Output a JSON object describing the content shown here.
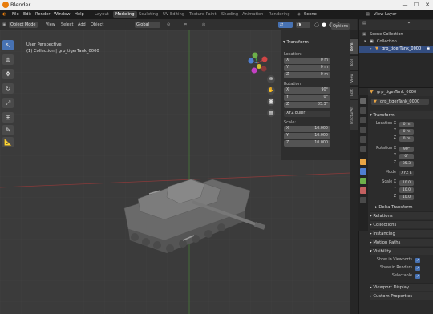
{
  "window": {
    "title": "Blender",
    "minimize": "—",
    "maximize": "☐",
    "close": "✕"
  },
  "menu": [
    "File",
    "Edit",
    "Render",
    "Window",
    "Help"
  ],
  "workspaces": [
    "Layout",
    "Modeling",
    "Sculpting",
    "UV Editing",
    "Texture Paint",
    "Shading",
    "Animation",
    "Rendering"
  ],
  "scene": {
    "label": "Scene",
    "view_layer": "View Layer"
  },
  "viewport_header": {
    "mode": "Object Mode",
    "view": "View",
    "select": "Select",
    "add": "Add",
    "object": "Object",
    "orientation": "Global",
    "options": "Options"
  },
  "viewport": {
    "perspective": "User Perspective",
    "collection_info": "(1) Collection | grp_tigerTank_0000"
  },
  "n_panel": {
    "title": "Transform",
    "location_label": "Location:",
    "location": [
      {
        "axis": "X",
        "value": "0 m"
      },
      {
        "axis": "Y",
        "value": "0 m"
      },
      {
        "axis": "Z",
        "value": "0 m"
      }
    ],
    "rotation_label": "Rotation:",
    "rotation": [
      {
        "axis": "X",
        "value": "90°"
      },
      {
        "axis": "Y",
        "value": "0°"
      },
      {
        "axis": "Z",
        "value": "85.3°"
      }
    ],
    "rotation_mode": "XYZ Euler",
    "scale_label": "Scale:",
    "scale": [
      {
        "axis": "X",
        "value": "10.000"
      },
      {
        "axis": "Y",
        "value": "10.000"
      },
      {
        "axis": "Z",
        "value": "10.000"
      }
    ]
  },
  "side_tabs": [
    "Item",
    "Tool",
    "View",
    "Edit",
    "FracturAlt"
  ],
  "outliner": {
    "root": "Scene Collection",
    "collection": "Collection",
    "object": "grp_tigerTank_0000"
  },
  "properties": {
    "object_name": "grp_tigerTank_0000",
    "object_field": "grp_tigerTank_0000",
    "transform_title": "Transform",
    "location": [
      {
        "label": "Location X",
        "value": "0 m"
      },
      {
        "label": "Y",
        "value": "0 m"
      },
      {
        "label": "Z",
        "value": "0 m"
      }
    ],
    "rotation": [
      {
        "label": "Rotation X",
        "value": "90°"
      },
      {
        "label": "Y",
        "value": "0°"
      },
      {
        "label": "Z",
        "value": "85.3"
      }
    ],
    "mode_label": "Mode",
    "mode_value": "XYZ E",
    "scale": [
      {
        "label": "Scale X",
        "value": "10.0"
      },
      {
        "label": "Y",
        "value": "10.0"
      },
      {
        "label": "Z",
        "value": "10.0"
      }
    ],
    "sections": [
      "Delta Transform",
      "Relations",
      "Collections",
      "Instancing",
      "Motion Paths",
      "Visibility"
    ],
    "visibility": [
      {
        "label": "Show in Viewports"
      },
      {
        "label": "Show in Renders"
      },
      {
        "label": "Selectable"
      }
    ],
    "bottom_sections": [
      "Viewport Display",
      "Custom Properties"
    ]
  }
}
